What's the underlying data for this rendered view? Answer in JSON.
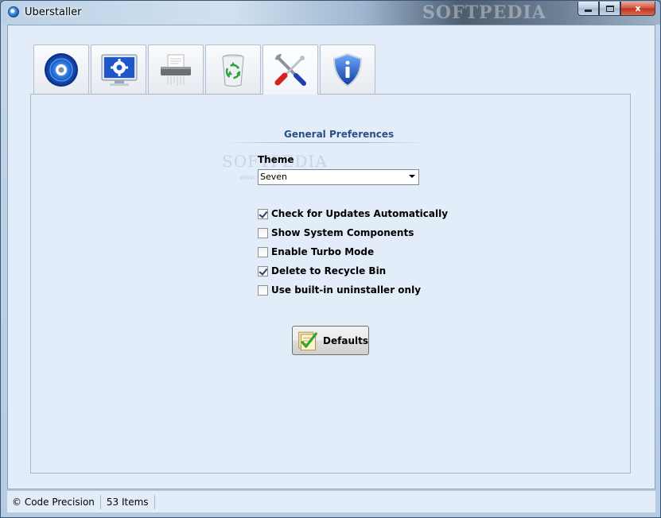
{
  "window": {
    "title": "Uberstaller",
    "watermark": "SOFTPEDIA",
    "minimize": "",
    "maximize": "",
    "close": "x"
  },
  "tabs": [
    {
      "id": "installed",
      "icon": "disc-icon",
      "active": false
    },
    {
      "id": "system",
      "icon": "monitor-gear-icon",
      "active": false
    },
    {
      "id": "shredder",
      "icon": "shredder-icon",
      "active": false
    },
    {
      "id": "recycle",
      "icon": "recycle-bin-icon",
      "active": false
    },
    {
      "id": "preferences",
      "icon": "tools-icon",
      "active": true
    },
    {
      "id": "about",
      "icon": "info-shield-icon",
      "active": false
    }
  ],
  "preferences": {
    "section_title": "General Preferences",
    "watermark": "SOFTPEDIA",
    "watermark_sub": "www.softpedia.com",
    "theme_label": "Theme",
    "theme_value": "Seven",
    "options": [
      {
        "label": "Check for Updates Automatically",
        "checked": true
      },
      {
        "label": "Show System Components",
        "checked": false
      },
      {
        "label": "Enable Turbo Mode",
        "checked": false
      },
      {
        "label": "Delete to Recycle Bin",
        "checked": true
      },
      {
        "label": "Use built-in uninstaller only",
        "checked": false
      }
    ],
    "defaults_label": "Defaults"
  },
  "status": {
    "copyright": "© Code Precision",
    "items": "53 Items"
  },
  "colors": {
    "section_title": "#2a4f85",
    "client_bg": "#e3edf9"
  }
}
